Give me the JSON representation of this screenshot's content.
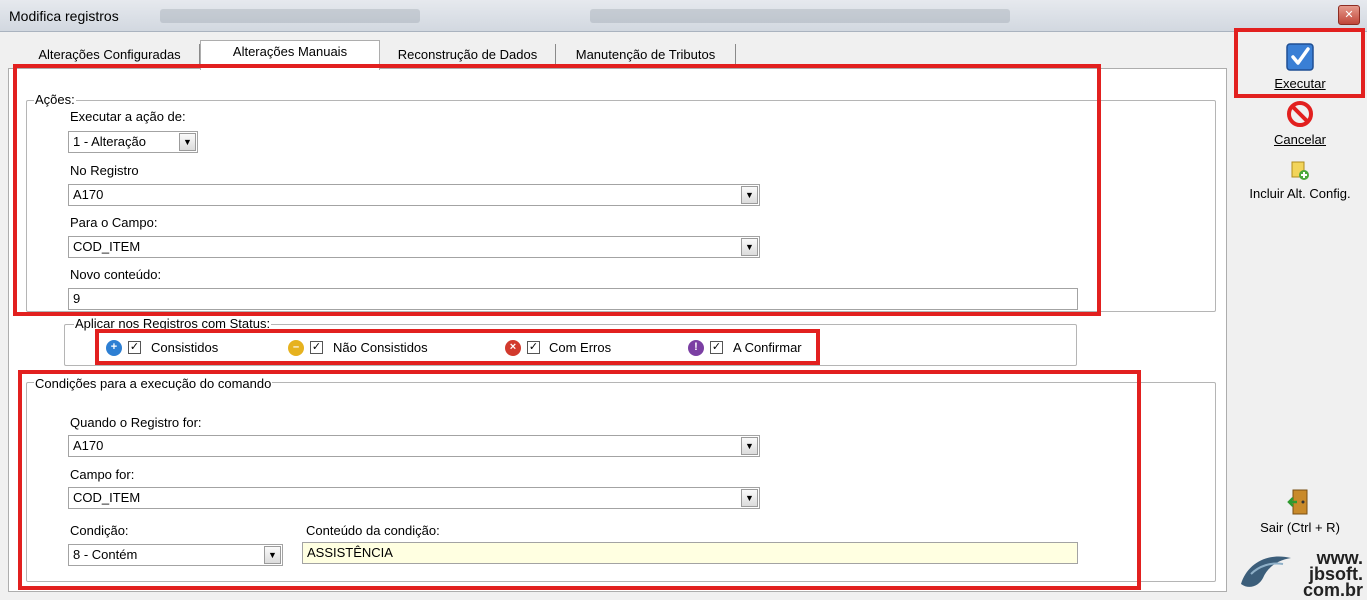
{
  "window": {
    "title": "Modifica registros",
    "close_glyph": "✕"
  },
  "tabs": [
    {
      "label": "Alterações Configuradas",
      "active": false
    },
    {
      "label": "Alterações Manuais",
      "active": true
    },
    {
      "label": "Reconstrução de Dados",
      "active": false
    },
    {
      "label": "Manutenção de Tributos",
      "active": false
    }
  ],
  "acoes": {
    "legend": "Ações:",
    "executar_label": "Executar a ação de:",
    "executar_value": "1 - Alteração",
    "registro_label": "No Registro",
    "registro_value": "A170",
    "campo_label": "Para o Campo:",
    "campo_value": "COD_ITEM",
    "novo_label": "Novo conteúdo:",
    "novo_value": "9"
  },
  "status": {
    "legend": "Aplicar nos Registros com Status:",
    "items": [
      {
        "label": "Consistidos",
        "checked": true,
        "icon": "plus-circle-icon",
        "color": "#2d7fd3"
      },
      {
        "label": "Não Consistidos",
        "checked": true,
        "icon": "minus-circle-icon",
        "color": "#e6b21f"
      },
      {
        "label": "Com Erros",
        "checked": true,
        "icon": "x-circle-icon",
        "color": "#d23a2d"
      },
      {
        "label": "A Confirmar",
        "checked": true,
        "icon": "exclamation-circle-icon",
        "color": "#7b3fa3"
      }
    ],
    "check_glyph": "✓"
  },
  "condicoes": {
    "legend": "Condições para a execução do comando",
    "registro_label": "Quando o Registro for:",
    "registro_value": "A170",
    "campo_label": "Campo for:",
    "campo_value": "COD_ITEM",
    "condicao_label": "Condição:",
    "condicao_value": "8 - Contém",
    "conteudo_label": "Conteúdo da condição:",
    "conteudo_value": "ASSISTÊNCIA"
  },
  "toolbar": {
    "executar": "Executar",
    "cancelar": "Cancelar",
    "incluir": "Incluir Alt. Config.",
    "sair": "Sair (Ctrl + R)"
  },
  "logo": {
    "line1": "www.",
    "line2": "jbsoft.",
    "line3": "com.br"
  },
  "colors": {
    "highlight": "#e2201f",
    "input_yellow": "#ffffe1"
  },
  "combo_arrow_glyph": "▼"
}
